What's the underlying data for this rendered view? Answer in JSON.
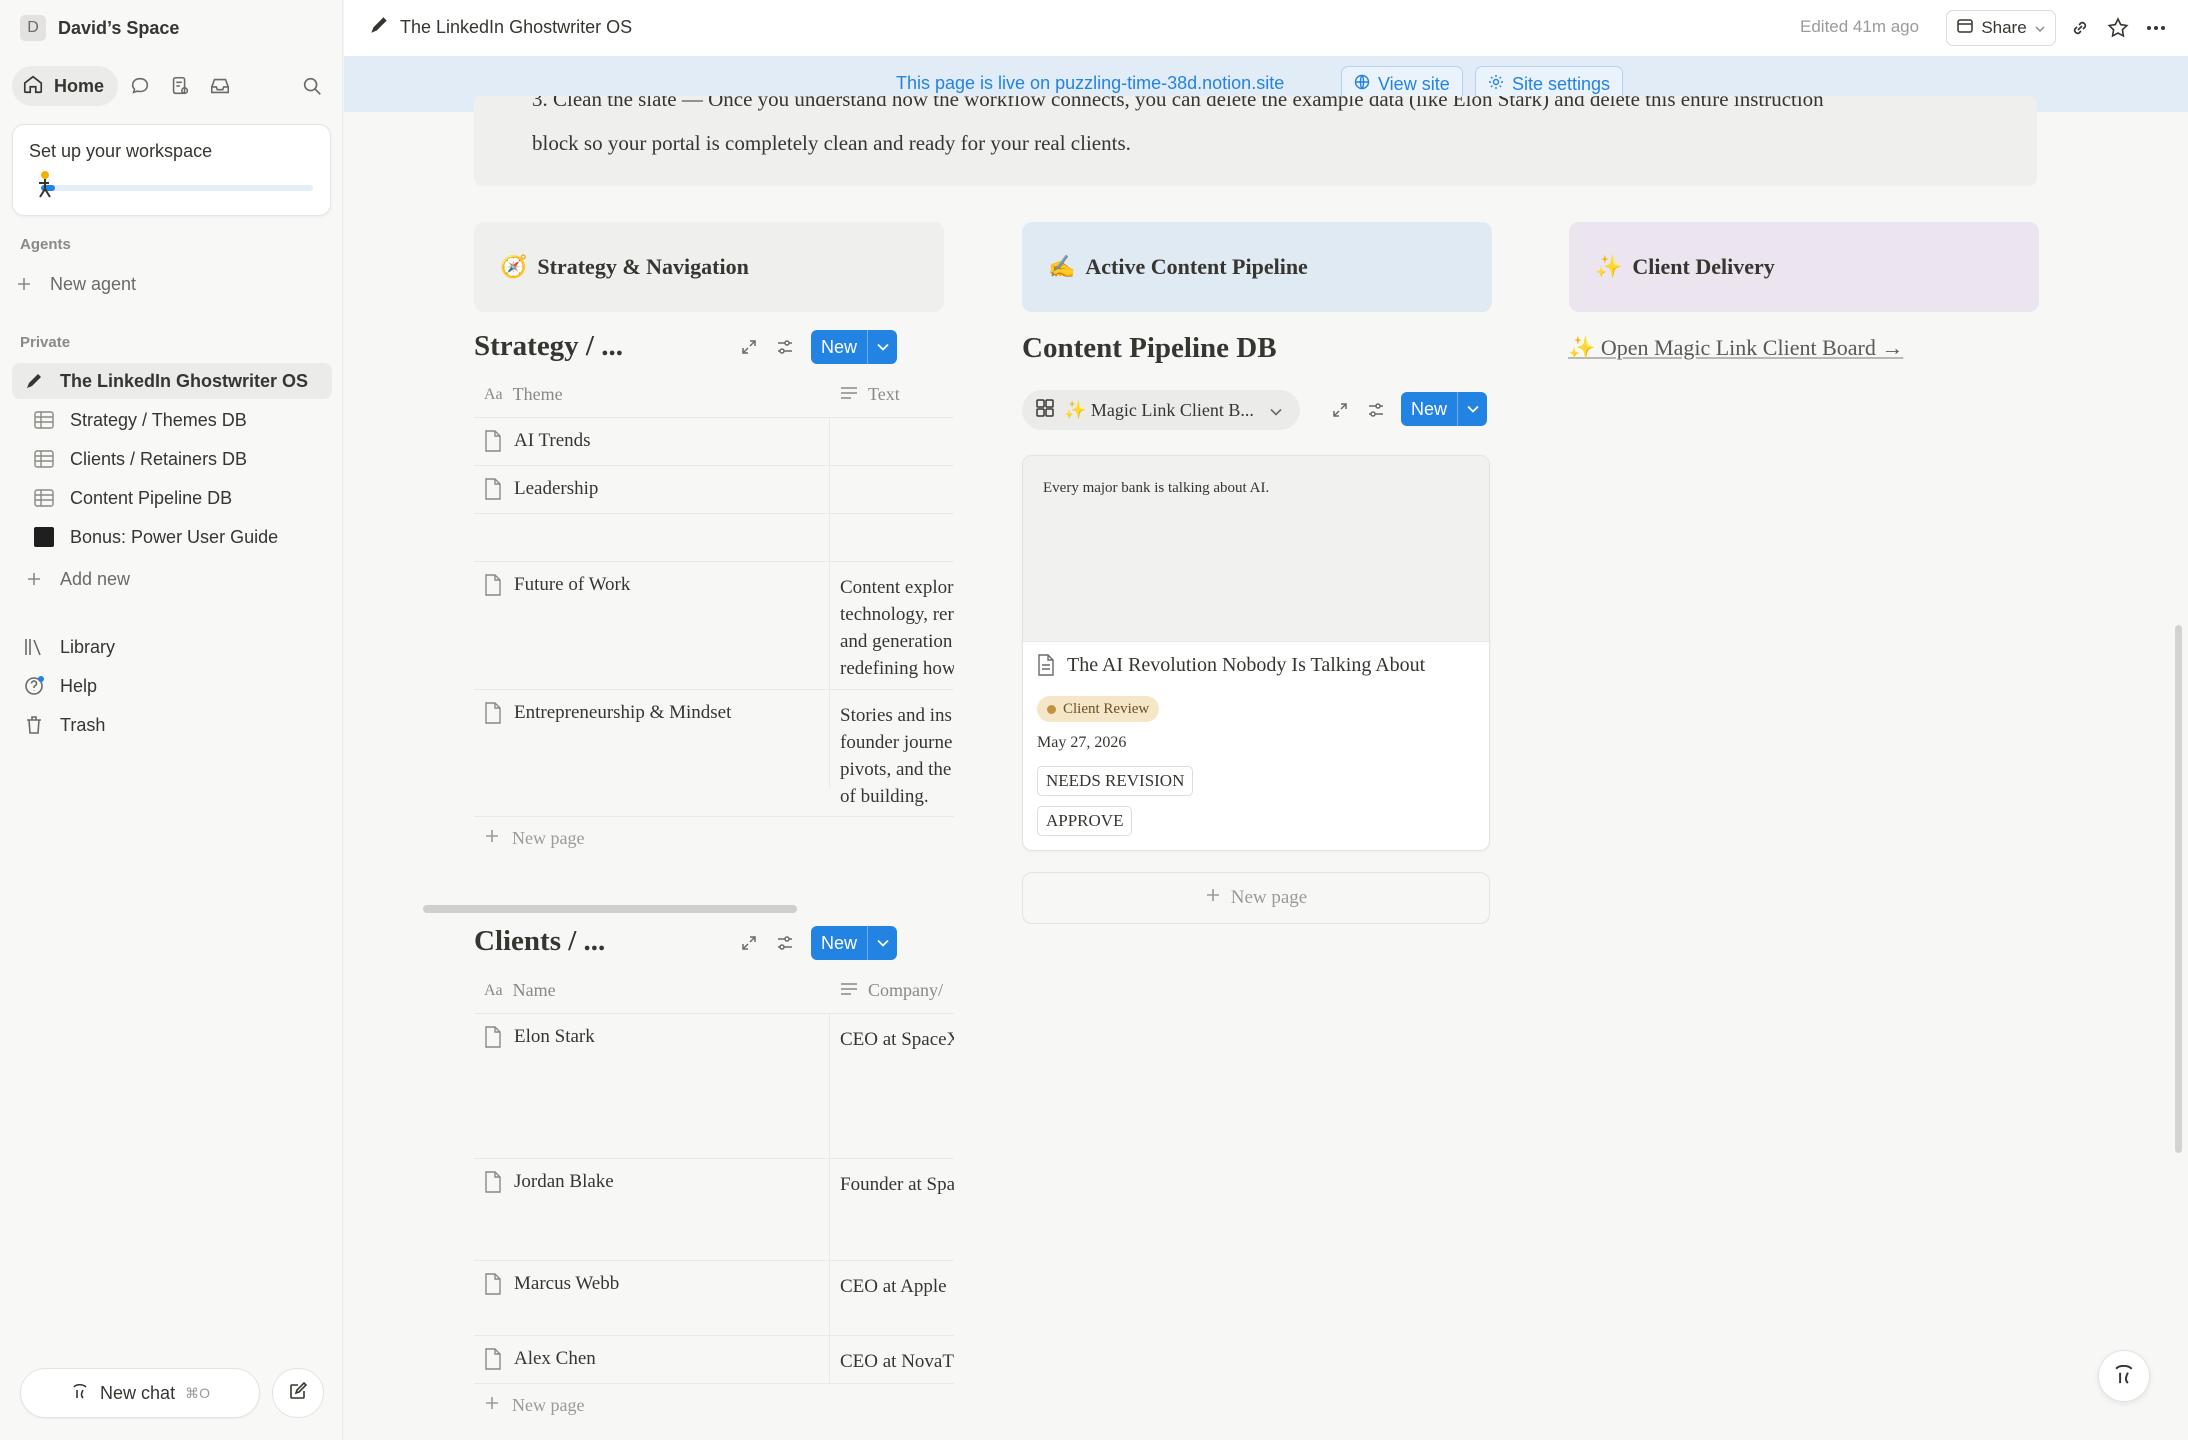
{
  "sidebar": {
    "workspace": {
      "avatar_letter": "D",
      "name": "David’s Space"
    },
    "nav": {
      "home_label": "Home"
    },
    "setup": {
      "title": "Set up your workspace",
      "progress": 0.05
    },
    "agents_label": "Agents",
    "new_agent": "New agent",
    "private_label": "Private",
    "pages": [
      {
        "label": "The LinkedIn Ghostwriter OS",
        "icon": "pen-icon",
        "active": true
      },
      {
        "label": "Strategy / Themes DB",
        "icon": "table-icon"
      },
      {
        "label": "Clients / Retainers DB",
        "icon": "table-icon"
      },
      {
        "label": "Content Pipeline DB",
        "icon": "table-icon"
      },
      {
        "label": "Bonus: Power User Guide",
        "icon": "black-square-icon"
      }
    ],
    "add_new": "Add new",
    "library": "Library",
    "help": "Help",
    "trash": "Trash",
    "new_chat": {
      "label": "New chat",
      "shortcut": "⌘O"
    }
  },
  "topbar": {
    "page_title": "The LinkedIn Ghostwriter OS",
    "edited": "Edited 41m ago",
    "share": "Share"
  },
  "banner": {
    "text": "This page is live on puzzling-time-38d.notion.site",
    "view_site": "View site",
    "site_settings": "Site settings"
  },
  "callout": {
    "line1": "3. Clean the slate — Once you understand how the workflow connects, you can delete the example data (like Elon Stark) and delete this entire instruction",
    "line2": "block so your portal is completely clean and ready for your real clients."
  },
  "columns": {
    "strategy": {
      "emoji": "🧭",
      "title": "Strategy & Navigation",
      "bg": "#efefed"
    },
    "pipeline": {
      "emoji": "✍️",
      "title": "Active Content Pipeline",
      "bg": "#dfeaf3"
    },
    "delivery": {
      "emoji": "✨",
      "title": "Client Delivery",
      "bg": "#ece4ef"
    }
  },
  "strategy_db": {
    "title": "Strategy / ...",
    "new_label": "New",
    "headers": {
      "name": "Theme",
      "text": "Text"
    },
    "rows": [
      {
        "name": "AI Trends",
        "text": []
      },
      {
        "name": "Leadership",
        "text": []
      },
      {
        "name": "",
        "text": []
      },
      {
        "name": "Future of Work",
        "text": [
          "Content explor",
          "technology, rer",
          "and generation",
          "redefining how"
        ]
      },
      {
        "name": "Entrepreneurship & Mindset",
        "text": [
          "Stories and ins",
          "founder journe",
          "pivots, and the",
          "of building."
        ]
      }
    ],
    "new_page": "New page"
  },
  "clients_db": {
    "title": "Clients / ...",
    "new_label": "New",
    "headers": {
      "name": "Name",
      "text": "Company/"
    },
    "rows": [
      {
        "name": "Elon Stark",
        "text": "CEO at SpaceX"
      },
      {
        "name": "Jordan Blake",
        "text": "Founder at Spa"
      },
      {
        "name": "Marcus Webb",
        "text": "CEO at Apple"
      },
      {
        "name": "Alex Chen",
        "text": "CEO at NovaT"
      }
    ],
    "new_page": "New page"
  },
  "pipeline_db": {
    "title": "Content Pipeline DB",
    "view": "✨ Magic Link Client B...",
    "new_label": "New",
    "card": {
      "cover_text": "Every major bank is talking about AI.",
      "title": "The AI Revolution Nobody Is Talking About",
      "status": "Client Review",
      "date": "May 27, 2026",
      "tags": [
        "NEEDS REVISION",
        "APPROVE"
      ]
    },
    "new_page": "New page"
  },
  "delivery": {
    "link": "✨ Open Magic Link Client Board →"
  }
}
